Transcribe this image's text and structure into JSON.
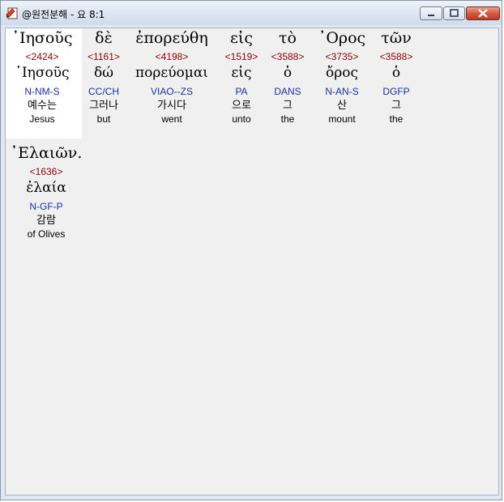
{
  "window": {
    "title": "@원전분해 - 요 8:1",
    "icon": "app-document-icon",
    "controls": [
      "minimize",
      "maximize",
      "close"
    ]
  },
  "words": [
    {
      "greek": "᾽Ιησοῦς",
      "strong": "<2424>",
      "lemma": "᾽Ιησοῦς",
      "parse": "N-NM-S",
      "korean": "예수는",
      "english": "Jesus"
    },
    {
      "greek": "δὲ",
      "strong": "<1161>",
      "lemma": "δώ",
      "parse": "CC/CH",
      "korean": "그러나",
      "english": "but"
    },
    {
      "greek": "ἐπορεύθη",
      "strong": "<4198>",
      "lemma": "πορεύομαι",
      "parse": "VIAO--ZS",
      "korean": "가시다",
      "english": "went"
    },
    {
      "greek": "εἰς",
      "strong": "<1519>",
      "lemma": "εἰς",
      "parse": "PA",
      "korean": "으로",
      "english": "unto"
    },
    {
      "greek": "τὸ",
      "strong": "<3588>",
      "lemma": "ὁ",
      "parse": "DANS",
      "korean": "그",
      "english": "the"
    },
    {
      "greek": "᾽Ορος",
      "strong": "<3735>",
      "lemma": "ὄρος",
      "parse": "N-AN-S",
      "korean": "산",
      "english": "mount"
    },
    {
      "greek": "τῶν",
      "strong": "<3588>",
      "lemma": "ὁ",
      "parse": "DGFP",
      "korean": "그",
      "english": "the"
    },
    {
      "greek": "᾽Ελαιῶν.",
      "strong": "<1636>",
      "lemma": "ἐλαία",
      "parse": "N-GF-P",
      "korean": "감람",
      "english": "of Olives"
    }
  ],
  "colors": {
    "strong": "#8b0000",
    "parse": "#1a2fa8",
    "selected_bg": "#ffffff",
    "client_bg": "#f0f0f0"
  }
}
